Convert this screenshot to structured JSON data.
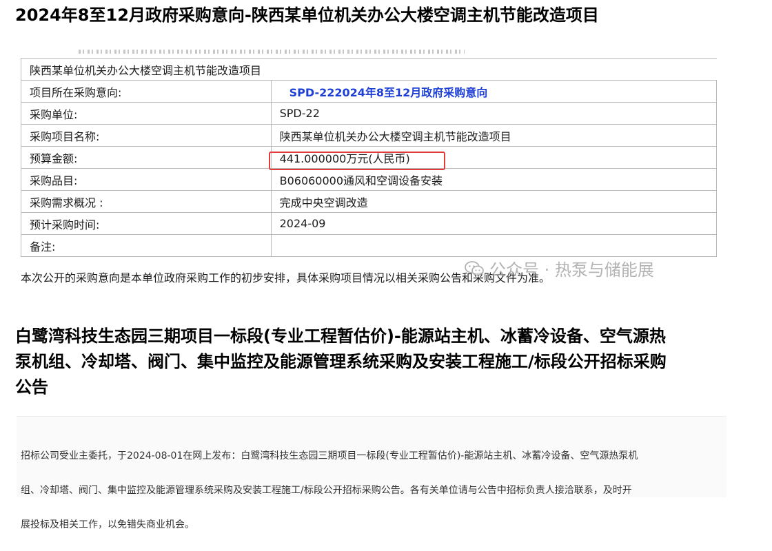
{
  "heading1": "2024年8至12月政府采购意向-陕西某单位机关办公大楼空调主机节能改造项目",
  "table": {
    "header": "陕西某单位机关办公大楼空调主机节能改造项目",
    "rows": [
      {
        "label": "项目所在采购意向:",
        "value": "SPD-222024年8至12月政府采购意向"
      },
      {
        "label": "采购单位:",
        "value": "SPD-22"
      },
      {
        "label": "采购项目名称:",
        "value": "陕西某单位机关办公大楼空调主机节能改造项目"
      },
      {
        "label": "预算金额:",
        "value": "441.000000万元(人民币)"
      },
      {
        "label": "采购品目:",
        "value": "B06060000通风和空调设备安装"
      },
      {
        "label": "采购需求概况 :",
        "value": "完成中央空调改造"
      },
      {
        "label": "预计采购时间:",
        "value": "2024-09"
      },
      {
        "label": "备注:",
        "value": ""
      }
    ],
    "note": "本次公开的采购意向是本单位政府采购工作的初步安排，具体采购项目情况以相关采购公告和采购文件为准。",
    "highlight_color": "#e23b3b",
    "link_color": "#1d3fd6"
  },
  "watermark": "公众号 · 热泵与储能展",
  "watermark_icon": "wechat-icon",
  "heading2": {
    "line1": "白鹭湾科技生态园三期项目一标段(专业工程暂估价)-能源站主机、冰蓄冷设备、空气源热",
    "line2": "泵机组、冷却塔、阀门、集中监控及能源管理系统采购及安装工程施工/标段公开招标采购",
    "line3": "公告"
  },
  "paragraph": {
    "line1": "招标公司受业主委托，于2024-08-01在网上发布：白鹭湾科技生态园三期项目一标段(专业工程暂估价)-能源站主机、冰蓄冷设备、空气源热泵机",
    "line2": "组、冷却塔、阀门、集中监控及能源管理系统采购及安装工程施工/标段公开招标采购公告。各有关单位请与公告中招标负责人接洽联系，及时开",
    "line3": "展投标及相关工作，以免错失商业机会。"
  }
}
